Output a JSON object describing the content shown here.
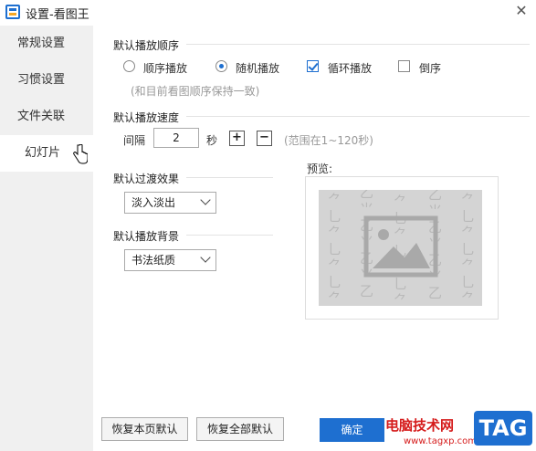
{
  "window": {
    "title": "设置-看图王",
    "close_glyph": "✕"
  },
  "sidebar": {
    "items": [
      {
        "label": "常规设置",
        "active": false
      },
      {
        "label": "习惯设置",
        "active": false
      },
      {
        "label": "文件关联",
        "active": false
      },
      {
        "label": "幻灯片",
        "active": true
      }
    ]
  },
  "play_order": {
    "heading": "默认播放顺序",
    "options": {
      "sequential": "顺序播放",
      "random": "随机播放"
    },
    "selected": "随机播放",
    "loop": {
      "label": "循环播放",
      "checked": true
    },
    "reverse": {
      "label": "倒序",
      "checked": false
    },
    "hint": "(和目前看图顺序保持一致)"
  },
  "play_speed": {
    "heading": "默认播放速度",
    "interval_label": "间隔",
    "interval_value": "2",
    "unit": "秒",
    "plus": "+",
    "minus": "−",
    "range_hint": "(范围在1~120秒)"
  },
  "transition": {
    "heading": "默认过渡效果",
    "selected": "淡入淡出"
  },
  "background": {
    "heading": "默认播放背景",
    "selected": "书法纸质"
  },
  "preview": {
    "label": "预览:"
  },
  "footer": {
    "reset_page": "恢复本页默认",
    "reset_all": "恢复全部默认",
    "ok": "确定"
  },
  "watermark": {
    "brand": "电脑技术网",
    "url": "www.tagxp.com",
    "tag": "TAG"
  }
}
